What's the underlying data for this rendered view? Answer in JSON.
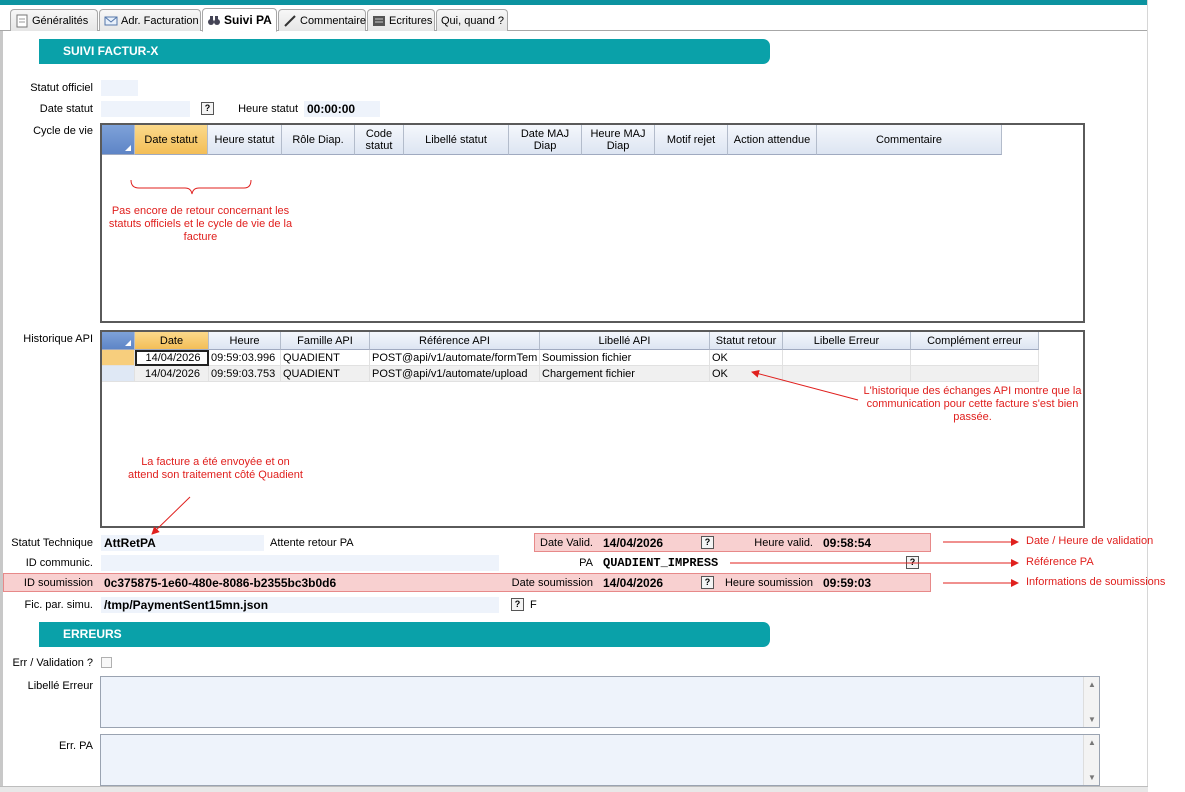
{
  "tabs": [
    {
      "label": "Généralités",
      "icon": "document-icon"
    },
    {
      "label": "Adr. Facturation",
      "icon": "envelope-icon"
    },
    {
      "label": "Suivi PA",
      "icon": "binoculars-icon",
      "active": true
    },
    {
      "label": "Commentaire",
      "icon": "pencil-icon"
    },
    {
      "label": "Ecritures",
      "icon": "ledger-icon"
    },
    {
      "label": "Qui, quand ?",
      "icon": ""
    }
  ],
  "section_suivi": "SUIVI FACTUR-X",
  "section_erreurs": "ERREURS",
  "labels": {
    "statut_officiel": "Statut officiel",
    "date_statut": "Date statut",
    "heure_statut": "Heure statut",
    "cycle_de_vie": "Cycle de vie",
    "historique_api": "Historique API",
    "statut_technique": "Statut Technique",
    "id_communic": "ID communic.",
    "id_soumission": "ID soumission",
    "fic_par_simu": "Fic. par. simu.",
    "pa": "PA",
    "date_valid": "Date Valid.",
    "heure_valid": "Heure valid.",
    "date_soumission": "Date soumission",
    "heure_soumission": "Heure soumission",
    "err_validation": "Err / Validation ?",
    "libelle_erreur": "Libellé Erreur",
    "err_pa": "Err. PA"
  },
  "values": {
    "heure_statut": "00:00:00",
    "statut_technique": "AttRetPA",
    "statut_technique_desc": "Attente retour PA",
    "pa": "QUADIENT_IMPRESS",
    "date_valid": "14/04/2026",
    "heure_valid": "09:58:54",
    "id_soumission": "0c375875-1e60-480e-8086-b2355bc3b0d6",
    "date_soumission": "14/04/2026",
    "heure_soumission": "09:59:03",
    "fic_par_simu": "/tmp/PaymentSent15mn.json",
    "fic_flag": "F",
    "help_glyph": "?"
  },
  "cycle_columns": [
    "Date statut",
    "Heure statut",
    "Rôle Diap.",
    "Code statut",
    "Libellé statut",
    "Date MAJ Diap",
    "Heure MAJ Diap",
    "Motif rejet",
    "Action attendue",
    "Commentaire"
  ],
  "api_columns": [
    "Date",
    "Heure",
    "Famille API",
    "Référence API",
    "Libellé API",
    "Statut retour",
    "Libelle Erreur",
    "Complément erreur"
  ],
  "api_rows": [
    [
      "14/04/2026",
      "09:59:03.996",
      "QUADIENT",
      "POST@api/v1/automate/formTem",
      "Soumission fichier",
      "OK",
      "",
      ""
    ],
    [
      "14/04/2026",
      "09:59:03.753",
      "QUADIENT",
      "POST@api/v1/automate/upload",
      "Chargement fichier",
      "OK",
      "",
      ""
    ]
  ],
  "notes": {
    "cycle": "Pas encore de retour concernant les statuts officiels et le cycle de vie de la facture",
    "api": "L'historique des échanges API montre que la communication pour cette facture s'est bien passée.",
    "sent": "La facture a été envoyée et on attend son traitement côté Quadient",
    "date_heure_validation": "Date / Heure de validation",
    "reference_pa": "Référence PA",
    "infos_soumission": "Informations de soumissions"
  },
  "colors": {
    "accent": "#0aa1a9",
    "annotation": "#e0201e",
    "field_bg": "#eef3fb",
    "header_sel": "#f3be57"
  }
}
